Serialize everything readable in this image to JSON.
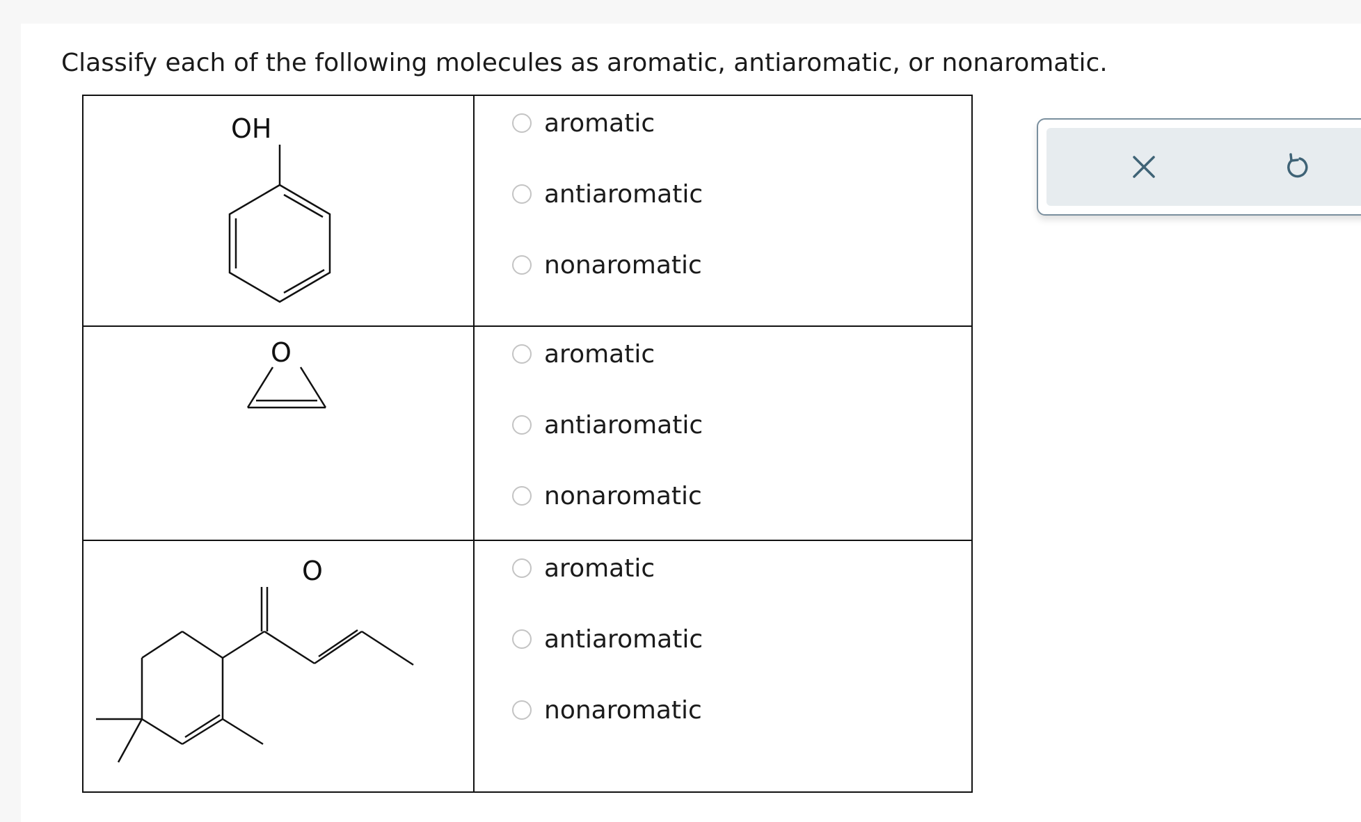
{
  "question": {
    "text": "Classify each of the following molecules as aromatic, antiaromatic, or nonaromatic."
  },
  "rows": [
    {
      "molecule": {
        "name": "phenol",
        "atom_labels": [
          "OH"
        ]
      },
      "options": [
        "aromatic",
        "antiaromatic",
        "nonaromatic"
      ]
    },
    {
      "molecule": {
        "name": "oxirene",
        "atom_labels": [
          "O"
        ]
      },
      "options": [
        "aromatic",
        "antiaromatic",
        "nonaromatic"
      ]
    },
    {
      "molecule": {
        "name": "cyclohexenyl-enone",
        "atom_labels": [
          "O"
        ]
      },
      "options": [
        "aromatic",
        "antiaromatic",
        "nonaromatic"
      ]
    }
  ],
  "toolbox": {
    "clear_icon": "close-icon",
    "undo_icon": "undo-icon",
    "border_color": "#7a8f9e",
    "background_color": "#e7ecef",
    "icon_color": "#3f6376"
  },
  "colors": {
    "radio_border": "#c4c4c4",
    "text": "#1a1a1a",
    "grid_lines": "#111111"
  }
}
